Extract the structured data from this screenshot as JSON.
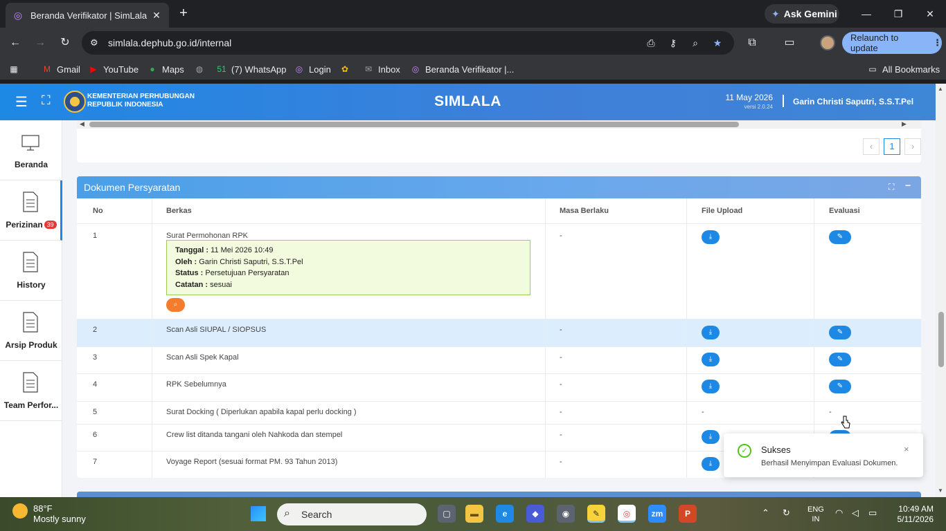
{
  "browser": {
    "tab_title": "Beranda Verifikator | SimLala",
    "new_tab": "+",
    "gemini_label": "Ask Gemini",
    "url": "simlala.dephub.go.id/internal",
    "relaunch_label": "Relaunch to update",
    "bookmarks": [
      {
        "label": "Gmail",
        "icon": "gmail-icon",
        "color": "#ea4335"
      },
      {
        "label": "YouTube",
        "icon": "youtube-icon",
        "color": "#ff0000"
      },
      {
        "label": "Maps",
        "icon": "maps-icon",
        "color": "#34a853"
      },
      {
        "label": "",
        "icon": "globe-icon",
        "color": "#9aa0a6"
      },
      {
        "label": "(7) WhatsApp",
        "icon": "whatsapp-icon",
        "color": "#25d366"
      },
      {
        "label": "Login",
        "icon": "login-icon",
        "color": "#c58af9"
      },
      {
        "label": "",
        "icon": "pinwheel-icon",
        "color": "#fbbc04"
      },
      {
        "label": "Inbox",
        "icon": "mail-icon",
        "color": "#9aa0a6"
      },
      {
        "label": "Beranda Verifikator |...",
        "icon": "simlala-icon",
        "color": "#c58af9"
      }
    ],
    "all_bookmarks": "All Bookmarks"
  },
  "app": {
    "ministry_line1": "KEMENTERIAN PERHUBUNGAN",
    "ministry_line2": "REPUBLIK INDONESIA",
    "title": "SIMLALA",
    "date": "11 May 2026",
    "version": "versi 2.0.24",
    "user": "Garin Christi Saputri, S.S.T.Pel",
    "accent": "#1e88e5"
  },
  "sidebar": {
    "items": [
      {
        "label": "Beranda",
        "icon": "monitor-icon"
      },
      {
        "label": "Perizinan",
        "icon": "document-icon",
        "badge": "39"
      },
      {
        "label": "History",
        "icon": "document-icon"
      },
      {
        "label": "Arsip Produk",
        "icon": "document-icon"
      },
      {
        "label": "Team Perfor...",
        "icon": "document-icon"
      }
    ]
  },
  "pagination": {
    "prev": "‹",
    "current": "1",
    "next": "›"
  },
  "section": {
    "title": "Dokumen Persyaratan",
    "columns": {
      "no": "No",
      "berkas": "Berkas",
      "masa": "Masa Berlaku",
      "file": "File Upload",
      "evaluasi": "Evaluasi"
    },
    "rows": [
      {
        "no": "1",
        "berkas": "Surat Permohonan RPK",
        "masa": "-",
        "file": "download",
        "eval": "edit"
      },
      {
        "no": "2",
        "berkas": "Scan Asli SIUPAL / SIOPSUS",
        "masa": "-",
        "file": "download",
        "eval": "edit"
      },
      {
        "no": "3",
        "berkas": "Scan Asli Spek Kapal",
        "masa": "-",
        "file": "download",
        "eval": "edit"
      },
      {
        "no": "4",
        "berkas": "RPK Sebelumnya",
        "masa": "-",
        "file": "download",
        "eval": "edit"
      },
      {
        "no": "5",
        "berkas": "Surat Docking ( Diperlukan apabila kapal perlu docking )",
        "masa": "-",
        "file": "-",
        "eval": "-"
      },
      {
        "no": "6",
        "berkas": "Crew list ditanda tangani oleh Nahkoda dan stempel",
        "masa": "-",
        "file": "download",
        "eval": "edit"
      },
      {
        "no": "7",
        "berkas": "Voyage Report (sesuai format PM. 93 Tahun 2013)",
        "masa": "-",
        "file": "download",
        "eval": "edit"
      }
    ],
    "detail": {
      "tanggal_label": "Tanggal :",
      "tanggal": "11 Mei 2026 10:49",
      "oleh_label": "Oleh :",
      "oleh": "Garin Christi Saputri, S.S.T.Pel",
      "status_label": "Status :",
      "status": "Persetujuan Persyaratan",
      "catatan_label": "Catatan :",
      "catatan": "sesuai"
    }
  },
  "toast": {
    "title": "Sukses",
    "message": "Berhasil Menyimpan Evaluasi Dokumen.",
    "close": "×"
  },
  "taskbar": {
    "temp": "88°F",
    "weather": "Mostly sunny",
    "search": "Search",
    "lang1": "ENG",
    "lang2": "IN",
    "time": "10:49 AM",
    "date": "5/11/2026"
  }
}
